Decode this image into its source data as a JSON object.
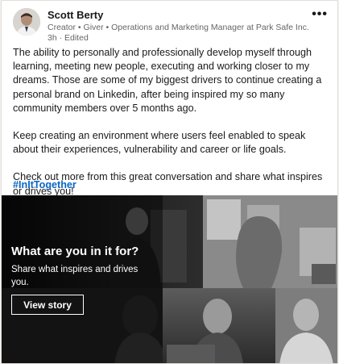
{
  "post": {
    "author_name": "Scott Berty",
    "author_meta": "Creator • Giver • Operations and Marketing Manager at Park Safe Inc.",
    "post_time": "3h · Edited",
    "more_label": "•••",
    "paragraphs": [
      "The ability to personally and professionally develop myself through learning, meeting new people, executing and working closer to my dreams. Those are some of my biggest drivers to continue creating a personal brand on Linkedin, after being inspired my so many community members over 5 months ago.",
      "Keep creating an environment where users feel enabled to speak about their experiences, vulnerability and career or life goals.",
      "Check out more from this great conversation and share what inspires or drives you!"
    ],
    "hashtag": "#InItTogether"
  },
  "media": {
    "title": "What are you in it for?",
    "subtitle": "Share what inspires and drives you.",
    "button_label": "View story"
  }
}
